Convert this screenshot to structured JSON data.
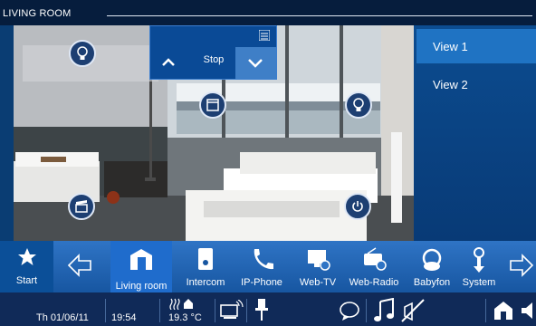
{
  "header": {
    "title": "LIVING ROOM"
  },
  "views": [
    {
      "label": "View 1"
    },
    {
      "label": "View 2"
    }
  ],
  "shade_control": {
    "label": "Stop"
  },
  "dock": {
    "start": "Start",
    "items": [
      "Living room",
      "Intercom",
      "IP-Phone",
      "Web-TV",
      "Web-Radio",
      "Babyfon",
      "System"
    ]
  },
  "status": {
    "date": "Th 01/06/11",
    "time": "19:54",
    "temperature": "19.3 °C"
  },
  "colors": {
    "bar": "#102a58",
    "accent": "#1f73c3",
    "dock": "#2f74c5"
  }
}
